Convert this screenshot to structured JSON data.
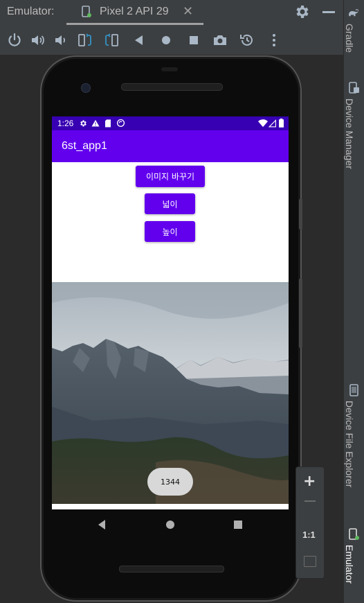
{
  "toolwindow": {
    "label": "Emulator:",
    "tab_title": "Pixel 2 API 29",
    "close_glyph": "✕"
  },
  "side_tabs": [
    {
      "label": "Gradle",
      "icon": "elephant-icon"
    },
    {
      "label": "Device Manager",
      "icon": "device-manager-icon"
    },
    {
      "label": "Device File Explorer",
      "icon": "device-file-explorer-icon"
    },
    {
      "label": "Emulator",
      "icon": "emulator-icon",
      "active": true
    }
  ],
  "toolbar_icons": [
    "power-icon",
    "volume-up-icon",
    "volume-down-icon",
    "rotate-left-icon",
    "rotate-right-icon",
    "back-icon",
    "home-icon",
    "overview-icon",
    "screenshot-icon",
    "snapshot-icon",
    "more-icon"
  ],
  "device": {
    "status_time": "1:26",
    "app_title": "6st_app1",
    "buttons": {
      "change_image": "이미지 바꾸기",
      "width": "넓이",
      "height": "높이"
    },
    "toast_text": "1344"
  },
  "zoom": {
    "plus": "+",
    "one_to_one": "1:1"
  },
  "colors": {
    "ide_bg": "#3c3f41",
    "canvas_bg": "#2b2b2b",
    "status_bar": "#3700b3",
    "primary": "#6200ee",
    "toast_bg": "#d8d8d8"
  }
}
